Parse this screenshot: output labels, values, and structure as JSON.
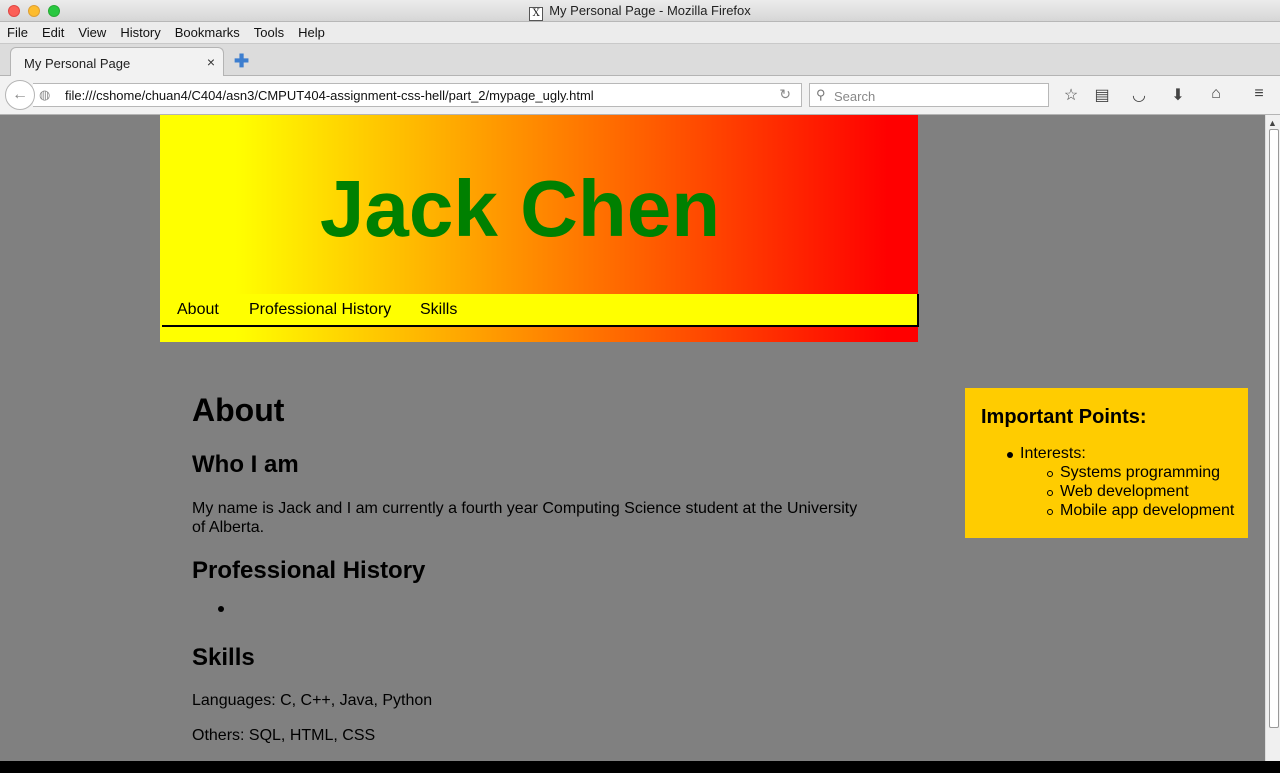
{
  "window": {
    "title": "My Personal Page - Mozilla Firefox"
  },
  "menu": [
    "File",
    "Edit",
    "View",
    "History",
    "Bookmarks",
    "Tools",
    "Help"
  ],
  "tab": {
    "label": "My Personal Page",
    "close": "×"
  },
  "navbar": {
    "url": "file:///cshome/chuan4/C404/asn3/CMPUT404-assignment-css-hell/part_2/mypage_ugly.html",
    "search_placeholder": "Search"
  },
  "page": {
    "header_title": "Jack Chen",
    "nav_links": [
      "About",
      "Professional History",
      "Skills"
    ],
    "about_heading": "About",
    "who_heading": "Who I am",
    "who_text": "My name is Jack and I am currently a fourth year Computing Science student at the University of Alberta.",
    "history_heading": "Professional History",
    "skills_heading": "Skills",
    "languages": "Languages: C, C++, Java, Python",
    "others": "Others: SQL, HTML, CSS"
  },
  "aside": {
    "heading": "Important Points:",
    "interests_label": "Interests:",
    "interests": [
      "Systems programming",
      "Web development",
      "Mobile app development"
    ]
  },
  "colors": {
    "page_bg": "#808080",
    "header_gradient_start": "#ffff00",
    "header_gradient_end": "#ff0000",
    "title_color": "#008000",
    "aside_bg": "#ffcc00"
  }
}
